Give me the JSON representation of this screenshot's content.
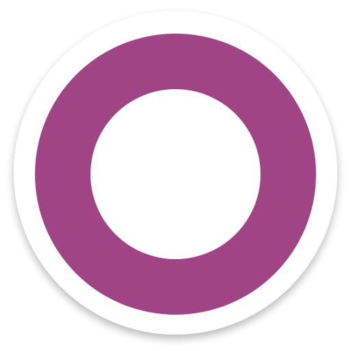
{
  "icon": {
    "name": "ring-logo-icon",
    "colors": {
      "ring": "#A14485",
      "base": "#FFFFFF",
      "center": "#FFFFFF",
      "shadow": "#000000"
    }
  }
}
